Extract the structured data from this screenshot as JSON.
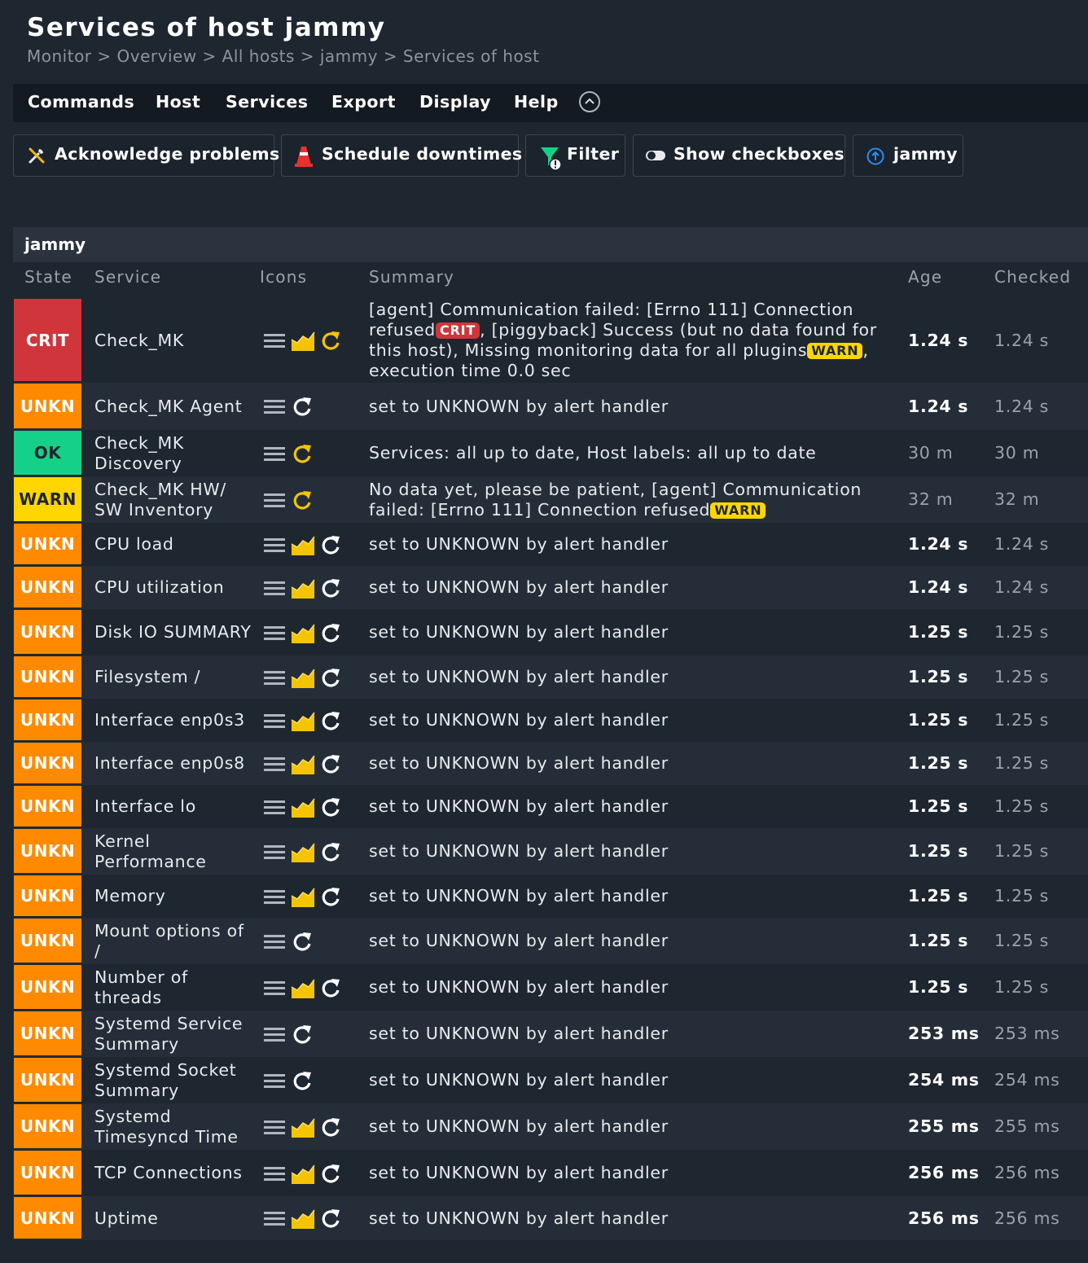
{
  "page": {
    "title": "Services of host jammy",
    "breadcrumb": "Monitor > Overview > All hosts > jammy > Services of host"
  },
  "menu": {
    "items": [
      "Commands",
      "Host",
      "Services",
      "Export",
      "Display",
      "Help"
    ]
  },
  "toolbar": {
    "acknowledge": "Acknowledge problems",
    "downtimes": "Schedule downtimes",
    "filter": "Filter",
    "checkboxes": "Show checkboxes",
    "host": "jammy"
  },
  "table": {
    "group": "jammy",
    "columns": [
      "State",
      "Service",
      "Icons",
      "Summary",
      "Age",
      "Checked"
    ],
    "colors": {
      "crit": "#d0353b",
      "unkn": "#ff8a00",
      "ok": "#15d188",
      "warn": "#ffd600"
    }
  },
  "rows": [
    {
      "state": "CRIT",
      "state_class": "crit",
      "service": "Check_MK",
      "icons": [
        "menu-icon",
        "graph-icon",
        "reschedule-icon"
      ],
      "summary_parts": [
        {
          "text": "[agent] Communication failed: [Errno 111] Connection refused"
        },
        {
          "pill": "CRIT",
          "pill_class": "crit"
        },
        {
          "text": ", [piggyback] Success (but no data found for this host), Missing monitoring data for all plugins"
        },
        {
          "pill": "WARN",
          "pill_class": "warn"
        },
        {
          "text": ", execution time 0.0 sec"
        }
      ],
      "age": "1.24 s",
      "age_recent": true,
      "checked": "1.24 s"
    },
    {
      "state": "UNKN",
      "state_class": "unkn",
      "service": "Check_MK Agent",
      "icons": [
        "menu-icon",
        "reschedule-icon"
      ],
      "summary": "set to UNKNOWN by alert handler",
      "age": "1.24 s",
      "age_recent": true,
      "checked": "1.24 s"
    },
    {
      "state": "OK",
      "state_class": "ok",
      "service": "Check_MK Discovery",
      "icons": [
        "menu-icon",
        "reschedule-icon"
      ],
      "summary": "Services: all up to date, Host labels: all up to date",
      "age": "30 m",
      "age_recent": false,
      "checked": "30 m"
    },
    {
      "state": "WARN",
      "state_class": "warn",
      "service": "Check_MK HW/ SW Inventory",
      "icons": [
        "menu-icon",
        "reschedule-icon"
      ],
      "summary_parts": [
        {
          "text": "No data yet, please be patient, [agent] Communication failed: [Errno 111] Connection refused"
        },
        {
          "pill": "WARN",
          "pill_class": "warn"
        }
      ],
      "age": "32 m",
      "age_recent": false,
      "checked": "32 m"
    },
    {
      "state": "UNKN",
      "state_class": "unkn",
      "service": "CPU load",
      "icons": [
        "menu-icon",
        "graph-icon",
        "reschedule-icon"
      ],
      "summary": "set to UNKNOWN by alert handler",
      "age": "1.24 s",
      "age_recent": true,
      "checked": "1.24 s"
    },
    {
      "state": "UNKN",
      "state_class": "unkn",
      "service": "CPU utilization",
      "icons": [
        "menu-icon",
        "graph-icon",
        "reschedule-icon"
      ],
      "summary": "set to UNKNOWN by alert handler",
      "age": "1.24 s",
      "age_recent": true,
      "checked": "1.24 s"
    },
    {
      "state": "UNKN",
      "state_class": "unkn",
      "service": "Disk IO SUMMARY",
      "icons": [
        "menu-icon",
        "graph-icon",
        "reschedule-icon"
      ],
      "summary": "set to UNKNOWN by alert handler",
      "age": "1.25 s",
      "age_recent": true,
      "checked": "1.25 s"
    },
    {
      "state": "UNKN",
      "state_class": "unkn",
      "service": "Filesystem /",
      "icons": [
        "menu-icon",
        "graph-icon",
        "reschedule-icon"
      ],
      "summary": "set to UNKNOWN by alert handler",
      "age": "1.25 s",
      "age_recent": true,
      "checked": "1.25 s"
    },
    {
      "state": "UNKN",
      "state_class": "unkn",
      "service": "Interface enp0s3",
      "icons": [
        "menu-icon",
        "graph-icon",
        "reschedule-icon"
      ],
      "summary": "set to UNKNOWN by alert handler",
      "age": "1.25 s",
      "age_recent": true,
      "checked": "1.25 s"
    },
    {
      "state": "UNKN",
      "state_class": "unkn",
      "service": "Interface enp0s8",
      "icons": [
        "menu-icon",
        "graph-icon",
        "reschedule-icon"
      ],
      "summary": "set to UNKNOWN by alert handler",
      "age": "1.25 s",
      "age_recent": true,
      "checked": "1.25 s"
    },
    {
      "state": "UNKN",
      "state_class": "unkn",
      "service": "Interface lo",
      "icons": [
        "menu-icon",
        "graph-icon",
        "reschedule-icon"
      ],
      "summary": "set to UNKNOWN by alert handler",
      "age": "1.25 s",
      "age_recent": true,
      "checked": "1.25 s"
    },
    {
      "state": "UNKN",
      "state_class": "unkn",
      "service": "Kernel Performance",
      "icons": [
        "menu-icon",
        "graph-icon",
        "reschedule-icon"
      ],
      "summary": "set to UNKNOWN by alert handler",
      "age": "1.25 s",
      "age_recent": true,
      "checked": "1.25 s"
    },
    {
      "state": "UNKN",
      "state_class": "unkn",
      "service": "Memory",
      "icons": [
        "menu-icon",
        "graph-icon",
        "reschedule-icon"
      ],
      "summary": "set to UNKNOWN by alert handler",
      "age": "1.25 s",
      "age_recent": true,
      "checked": "1.25 s"
    },
    {
      "state": "UNKN",
      "state_class": "unkn",
      "service": "Mount options of /",
      "icons": [
        "menu-icon",
        "reschedule-icon"
      ],
      "summary": "set to UNKNOWN by alert handler",
      "age": "1.25 s",
      "age_recent": true,
      "checked": "1.25 s"
    },
    {
      "state": "UNKN",
      "state_class": "unkn",
      "service": "Number of threads",
      "icons": [
        "menu-icon",
        "graph-icon",
        "reschedule-icon"
      ],
      "summary": "set to UNKNOWN by alert handler",
      "age": "1.25 s",
      "age_recent": true,
      "checked": "1.25 s"
    },
    {
      "state": "UNKN",
      "state_class": "unkn",
      "service": "Systemd Service Summary",
      "icons": [
        "menu-icon",
        "reschedule-icon"
      ],
      "summary": "set to UNKNOWN by alert handler",
      "age": "253 ms",
      "age_recent": true,
      "checked": "253 ms"
    },
    {
      "state": "UNKN",
      "state_class": "unkn",
      "service": "Systemd Socket Summary",
      "icons": [
        "menu-icon",
        "reschedule-icon"
      ],
      "summary": "set to UNKNOWN by alert handler",
      "age": "254 ms",
      "age_recent": true,
      "checked": "254 ms"
    },
    {
      "state": "UNKN",
      "state_class": "unkn",
      "service": "Systemd Timesyncd Time",
      "icons": [
        "menu-icon",
        "graph-icon",
        "reschedule-icon"
      ],
      "summary": "set to UNKNOWN by alert handler",
      "age": "255 ms",
      "age_recent": true,
      "checked": "255 ms"
    },
    {
      "state": "UNKN",
      "state_class": "unkn",
      "service": "TCP Connections",
      "icons": [
        "menu-icon",
        "graph-icon",
        "reschedule-icon"
      ],
      "summary": "set to UNKNOWN by alert handler",
      "age": "256 ms",
      "age_recent": true,
      "checked": "256 ms"
    },
    {
      "state": "UNKN",
      "state_class": "unkn",
      "service": "Uptime",
      "icons": [
        "menu-icon",
        "graph-icon",
        "reschedule-icon"
      ],
      "summary": "set to UNKNOWN by alert handler",
      "age": "256 ms",
      "age_recent": true,
      "checked": "256 ms"
    }
  ]
}
